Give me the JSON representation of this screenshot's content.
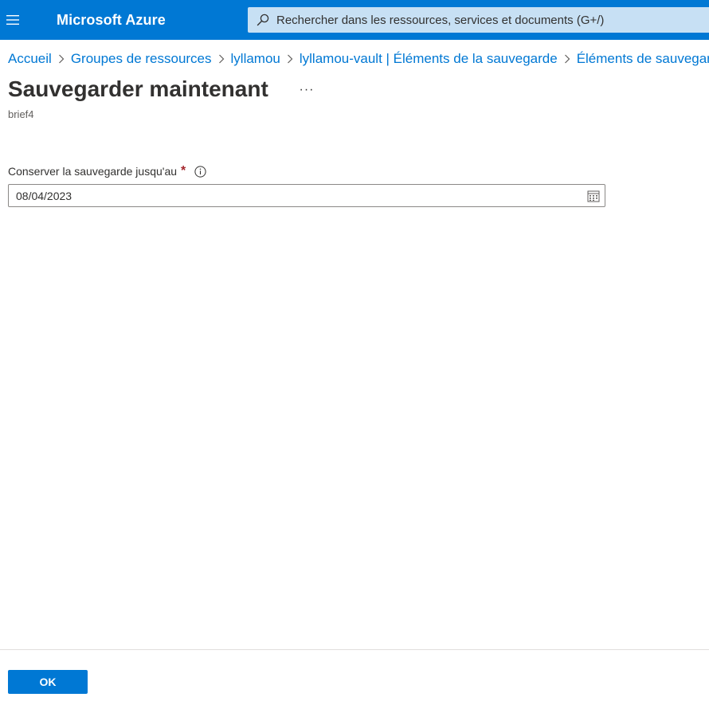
{
  "header": {
    "menu_icon": "hamburger-icon",
    "brand": "Microsoft Azure",
    "search": {
      "icon": "search-icon",
      "placeholder": "Rechercher dans les ressources, services et documents (G+/)"
    }
  },
  "breadcrumb": {
    "items": [
      "Accueil",
      "Groupes de ressources",
      "lyllamou",
      "lyllamou-vault | Éléments de la sauvegarde",
      "Éléments de sauvegarde"
    ],
    "separator_icon": "chevron-right-icon"
  },
  "page": {
    "title": "Sauvegarder maintenant",
    "more_label": "···",
    "subtitle": "brief4"
  },
  "form": {
    "retain_label": "Conserver la sauvegarde jusqu'au",
    "required_mark": "*",
    "info_icon": "info-icon",
    "retain_value": "08/04/2023",
    "calendar_icon": "calendar-icon"
  },
  "footer": {
    "ok_label": "OK"
  },
  "colors": {
    "accent": "#0078d4",
    "search_bg": "#c7e0f4",
    "required": "#a4262c"
  }
}
